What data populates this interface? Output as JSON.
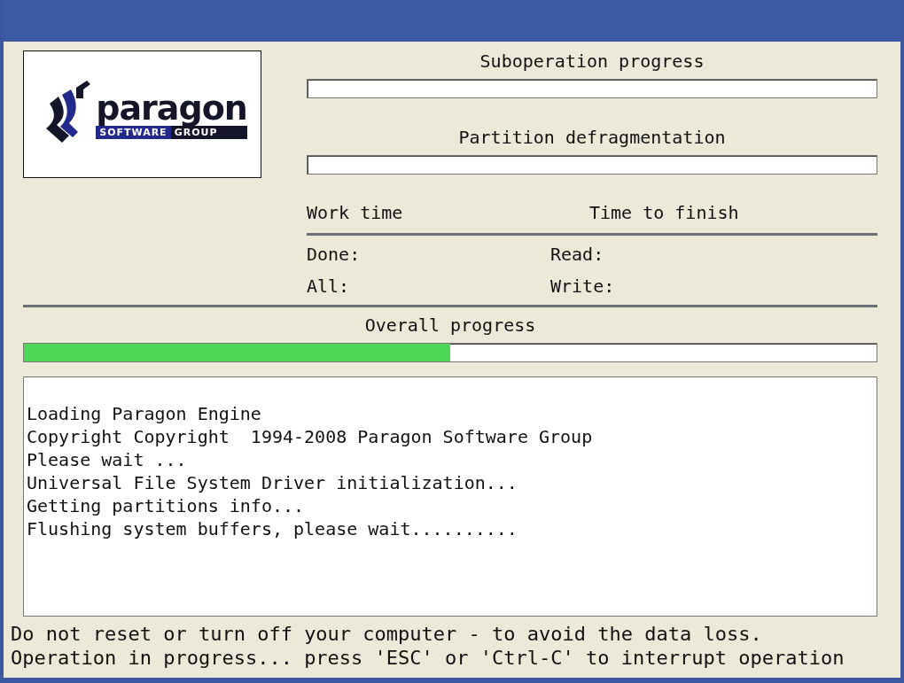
{
  "logo": {
    "name": "paragon",
    "tagline_left": "SOFTWARE",
    "tagline_right": "GROUP"
  },
  "suboperation": {
    "label": "Suboperation progress"
  },
  "operation": {
    "label": "Partition defragmentation"
  },
  "times": {
    "work_time": "Work time",
    "time_to_finish": "Time to finish"
  },
  "stats": [
    {
      "label": "Done:"
    },
    {
      "label": "Read:"
    },
    {
      "label": "All:"
    },
    {
      "label": "Write:"
    }
  ],
  "overall": {
    "label": "Overall progress",
    "level": 0.5
  },
  "log": [
    "Loading Paragon Engine",
    "Copyright Copyright  1994-2008 Paragon Software Group",
    "Please wait ...",
    "Universal File System Driver initialization...",
    "Getting partitions info...",
    "Flushing system buffers, please wait.........."
  ],
  "status_lines": [
    "Do not reset or turn off your computer - to avoid the data loss.",
    "Operation in progress... press 'ESC' or 'Ctrl-C' to interrupt operation"
  ]
}
